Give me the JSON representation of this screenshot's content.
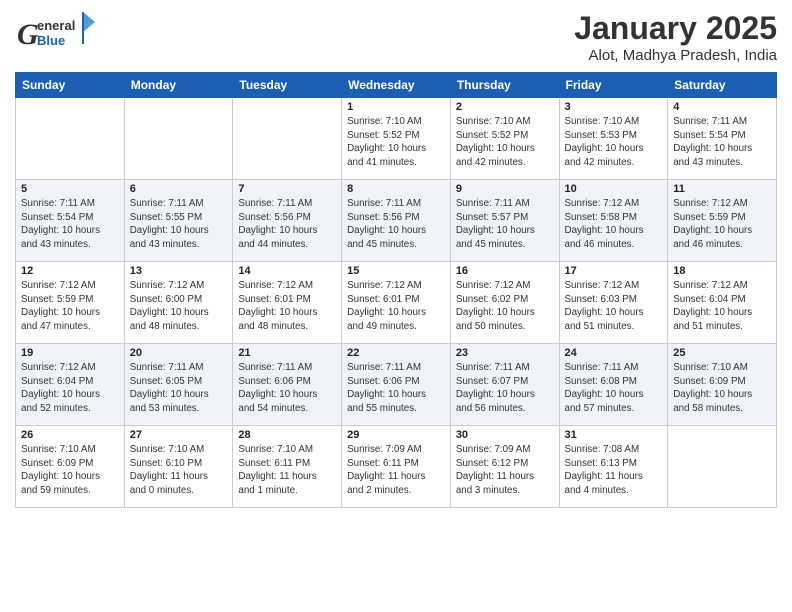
{
  "header": {
    "logo_general": "General",
    "logo_blue": "Blue",
    "month_title": "January 2025",
    "subtitle": "Alot, Madhya Pradesh, India"
  },
  "days_of_week": [
    "Sunday",
    "Monday",
    "Tuesday",
    "Wednesday",
    "Thursday",
    "Friday",
    "Saturday"
  ],
  "weeks": [
    [
      {
        "day": "",
        "info": ""
      },
      {
        "day": "",
        "info": ""
      },
      {
        "day": "",
        "info": ""
      },
      {
        "day": "1",
        "info": "Sunrise: 7:10 AM\nSunset: 5:52 PM\nDaylight: 10 hours\nand 41 minutes."
      },
      {
        "day": "2",
        "info": "Sunrise: 7:10 AM\nSunset: 5:52 PM\nDaylight: 10 hours\nand 42 minutes."
      },
      {
        "day": "3",
        "info": "Sunrise: 7:10 AM\nSunset: 5:53 PM\nDaylight: 10 hours\nand 42 minutes."
      },
      {
        "day": "4",
        "info": "Sunrise: 7:11 AM\nSunset: 5:54 PM\nDaylight: 10 hours\nand 43 minutes."
      }
    ],
    [
      {
        "day": "5",
        "info": "Sunrise: 7:11 AM\nSunset: 5:54 PM\nDaylight: 10 hours\nand 43 minutes."
      },
      {
        "day": "6",
        "info": "Sunrise: 7:11 AM\nSunset: 5:55 PM\nDaylight: 10 hours\nand 43 minutes."
      },
      {
        "day": "7",
        "info": "Sunrise: 7:11 AM\nSunset: 5:56 PM\nDaylight: 10 hours\nand 44 minutes."
      },
      {
        "day": "8",
        "info": "Sunrise: 7:11 AM\nSunset: 5:56 PM\nDaylight: 10 hours\nand 45 minutes."
      },
      {
        "day": "9",
        "info": "Sunrise: 7:11 AM\nSunset: 5:57 PM\nDaylight: 10 hours\nand 45 minutes."
      },
      {
        "day": "10",
        "info": "Sunrise: 7:12 AM\nSunset: 5:58 PM\nDaylight: 10 hours\nand 46 minutes."
      },
      {
        "day": "11",
        "info": "Sunrise: 7:12 AM\nSunset: 5:59 PM\nDaylight: 10 hours\nand 46 minutes."
      }
    ],
    [
      {
        "day": "12",
        "info": "Sunrise: 7:12 AM\nSunset: 5:59 PM\nDaylight: 10 hours\nand 47 minutes."
      },
      {
        "day": "13",
        "info": "Sunrise: 7:12 AM\nSunset: 6:00 PM\nDaylight: 10 hours\nand 48 minutes."
      },
      {
        "day": "14",
        "info": "Sunrise: 7:12 AM\nSunset: 6:01 PM\nDaylight: 10 hours\nand 48 minutes."
      },
      {
        "day": "15",
        "info": "Sunrise: 7:12 AM\nSunset: 6:01 PM\nDaylight: 10 hours\nand 49 minutes."
      },
      {
        "day": "16",
        "info": "Sunrise: 7:12 AM\nSunset: 6:02 PM\nDaylight: 10 hours\nand 50 minutes."
      },
      {
        "day": "17",
        "info": "Sunrise: 7:12 AM\nSunset: 6:03 PM\nDaylight: 10 hours\nand 51 minutes."
      },
      {
        "day": "18",
        "info": "Sunrise: 7:12 AM\nSunset: 6:04 PM\nDaylight: 10 hours\nand 51 minutes."
      }
    ],
    [
      {
        "day": "19",
        "info": "Sunrise: 7:12 AM\nSunset: 6:04 PM\nDaylight: 10 hours\nand 52 minutes."
      },
      {
        "day": "20",
        "info": "Sunrise: 7:11 AM\nSunset: 6:05 PM\nDaylight: 10 hours\nand 53 minutes."
      },
      {
        "day": "21",
        "info": "Sunrise: 7:11 AM\nSunset: 6:06 PM\nDaylight: 10 hours\nand 54 minutes."
      },
      {
        "day": "22",
        "info": "Sunrise: 7:11 AM\nSunset: 6:06 PM\nDaylight: 10 hours\nand 55 minutes."
      },
      {
        "day": "23",
        "info": "Sunrise: 7:11 AM\nSunset: 6:07 PM\nDaylight: 10 hours\nand 56 minutes."
      },
      {
        "day": "24",
        "info": "Sunrise: 7:11 AM\nSunset: 6:08 PM\nDaylight: 10 hours\nand 57 minutes."
      },
      {
        "day": "25",
        "info": "Sunrise: 7:10 AM\nSunset: 6:09 PM\nDaylight: 10 hours\nand 58 minutes."
      }
    ],
    [
      {
        "day": "26",
        "info": "Sunrise: 7:10 AM\nSunset: 6:09 PM\nDaylight: 10 hours\nand 59 minutes."
      },
      {
        "day": "27",
        "info": "Sunrise: 7:10 AM\nSunset: 6:10 PM\nDaylight: 11 hours\nand 0 minutes."
      },
      {
        "day": "28",
        "info": "Sunrise: 7:10 AM\nSunset: 6:11 PM\nDaylight: 11 hours\nand 1 minute."
      },
      {
        "day": "29",
        "info": "Sunrise: 7:09 AM\nSunset: 6:11 PM\nDaylight: 11 hours\nand 2 minutes."
      },
      {
        "day": "30",
        "info": "Sunrise: 7:09 AM\nSunset: 6:12 PM\nDaylight: 11 hours\nand 3 minutes."
      },
      {
        "day": "31",
        "info": "Sunrise: 7:08 AM\nSunset: 6:13 PM\nDaylight: 11 hours\nand 4 minutes."
      },
      {
        "day": "",
        "info": ""
      }
    ]
  ]
}
